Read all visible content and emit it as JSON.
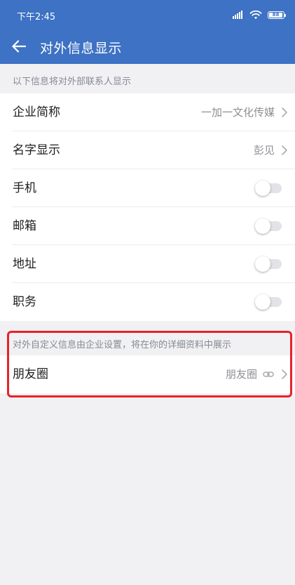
{
  "status_bar": {
    "time": "下午2:45",
    "battery": "88",
    "icons": [
      "signal-icon",
      "wifi-icon",
      "battery-icon"
    ]
  },
  "app_bar": {
    "title": "对外信息显示",
    "back_icon": "arrow-left-icon"
  },
  "section1": {
    "header": "以下信息将对外部联系人显示",
    "items": [
      {
        "label": "企业简称",
        "value": "一加一文化传媒",
        "type": "nav"
      },
      {
        "label": "名字显示",
        "value": "彭见",
        "type": "nav"
      },
      {
        "label": "手机",
        "type": "toggle",
        "on": false
      },
      {
        "label": "邮箱",
        "type": "toggle",
        "on": false
      },
      {
        "label": "地址",
        "type": "toggle",
        "on": false
      },
      {
        "label": "职务",
        "type": "toggle",
        "on": false
      }
    ]
  },
  "section2": {
    "header": "对外自定义信息由企业设置，将在你的详细资料中展示",
    "items": [
      {
        "label": "朋友圈",
        "value": "朋友圈",
        "type": "nav-link",
        "icon": "link-icon"
      }
    ]
  },
  "colors": {
    "primary": "#3d72c4",
    "background": "#f1f1f3",
    "highlight": "#e8222a",
    "secondary_text": "#8e8f94"
  }
}
